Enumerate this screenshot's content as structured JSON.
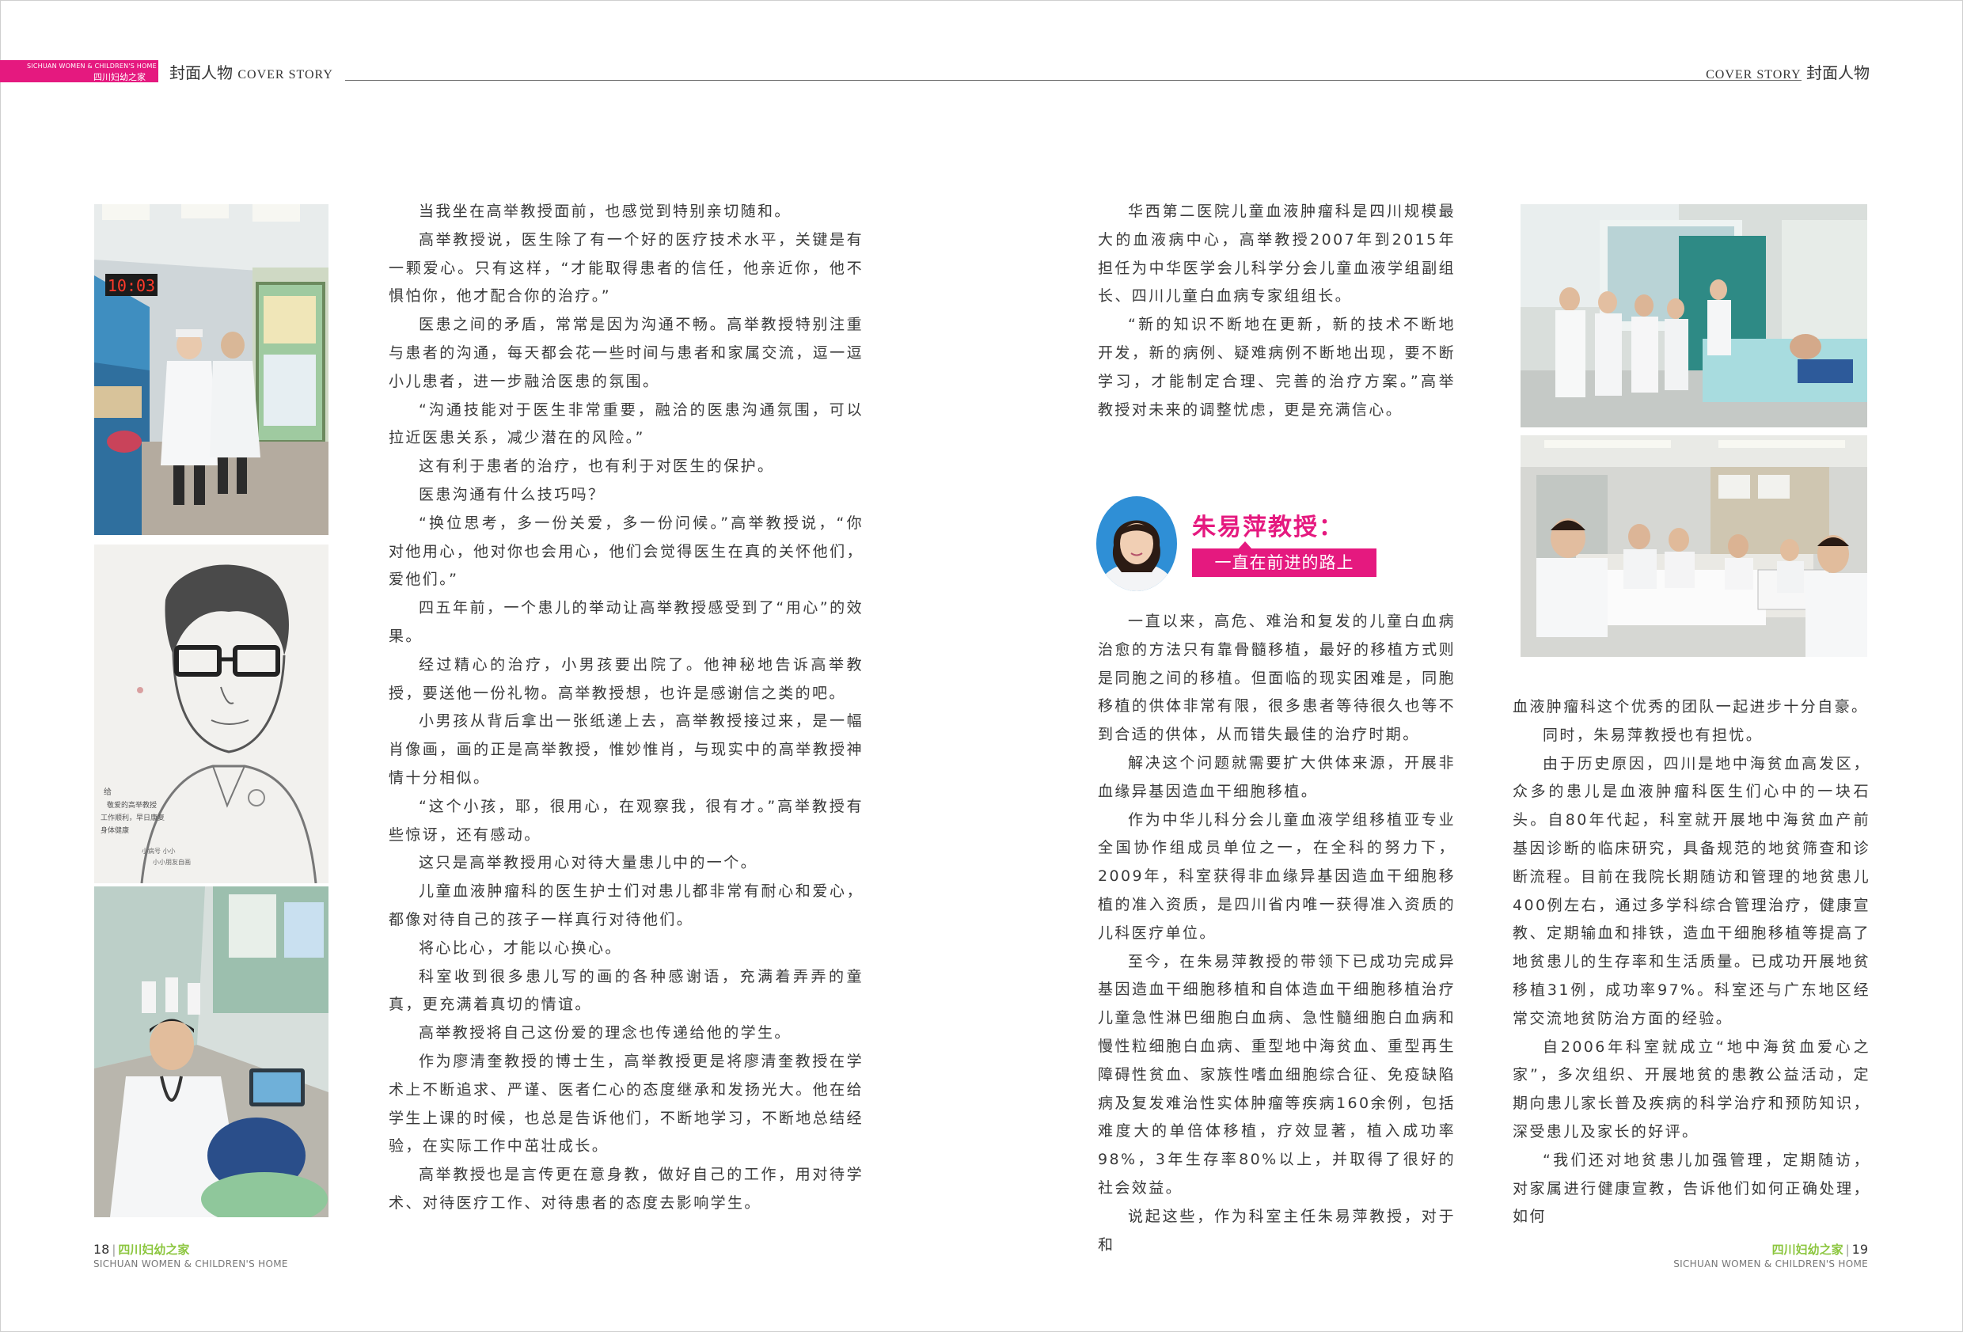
{
  "header": {
    "tab_en": "SICHUAN WOMEN & CHILDREN'S HOME",
    "tab_cn": "四川妇幼之家",
    "left_cn": "封面人物",
    "left_en": "COVER STORY",
    "right_en": "COVER STORY",
    "right_cn": "封面人物"
  },
  "photos": {
    "clock_text": "10:03",
    "drawing_note_1": "给",
    "drawing_note_2": "敬爱的高举教授",
    "drawing_note_3": "工作顺利，早日康复",
    "drawing_note_4": "身体健康",
    "drawing_note_5": "小病号 小小",
    "drawing_note_6": "小小朋友自画"
  },
  "left_page": {
    "paragraphs": [
      "当我坐在高举教授面前，也感觉到特别亲切随和。",
      "高举教授说，医生除了有一个好的医疗技术水平，关键是有一颗爱心。只有这样，“才能取得患者的信任，他亲近你，他不惧怕你，他才配合你的治疗。”",
      "医患之间的矛盾，常常是因为沟通不畅。高举教授特别注重与患者的沟通，每天都会花一些时间与患者和家属交流，逗一逗小儿患者，进一步融洽医患的氛围。",
      "“沟通技能对于医生非常重要，融洽的医患沟通氛围，可以拉近医患关系，减少潜在的风险。”",
      "这有利于患者的治疗，也有利于对医生的保护。",
      "医患沟通有什么技巧吗？",
      "“换位思考，多一份关爱，多一份问候。”高举教授说，“你对他用心，他对你也会用心，他们会觉得医生在真的关怀他们，爱他们。”",
      "四五年前，一个患儿的举动让高举教授感受到了“用心”的效果。",
      "经过精心的治疗，小男孩要出院了。他神秘地告诉高举教授，要送他一份礼物。高举教授想，也许是感谢信之类的吧。",
      "小男孩从背后拿出一张纸递上去，高举教授接过来，是一幅肖像画，画的正是高举教授，惟妙惟肖，与现实中的高举教授神情十分相似。",
      "“这个小孩，耶，很用心，在观察我，很有才。”高举教授有些惊讶，还有感动。",
      "这只是高举教授用心对待大量患儿中的一个。",
      "儿童血液肿瘤科的医生护士们对患儿都非常有耐心和爱心，都像对待自己的孩子一样真行对待他们。",
      "将心比心，才能以心换心。",
      "科室收到很多患儿写的画的各种感谢语，充满着弄弄的童真，更充满着真切的情谊。",
      "高举教授将自己这份爱的理念也传递给他的学生。",
      "作为廖清奎教授的博士生，高举教授更是将廖清奎教授在学术上不断追求、严谨、医者仁心的态度继承和发扬光大。他在给学生上课的时候，也总是告诉他们，不断地学习，不断地总结经验，在实际工作中茁壮成长。",
      "高举教授也是言传更在意身教，做好自己的工作，用对待学术、对待医疗工作、对待患者的态度去影响学生。"
    ]
  },
  "right_page": {
    "col1_top": [
      "华西第二医院儿童血液肿瘤科是四川规模最大的血液病中心，高举教授2007年到2015年担任为中华医学会儿科学分会儿童血液学组副组长、四川儿童白血病专家组组长。",
      "“新的知识不断地在更新，新的技术不断地开发，新的病例、疑难病例不断地出现，要不断学习，才能制定合理、完善的治疗方案。”高举教授对未来的调整忧虑，更是充满信心。"
    ],
    "section": {
      "name": "朱易萍教授：",
      "tagline": "一直在前进的路上"
    },
    "col1_bottom": [
      "一直以来，高危、难治和复发的儿童白血病治愈的方法只有靠骨髓移植，最好的移植方式则是同胞之间的移植。但面临的现实困难是，同胞移植的供体非常有限，很多患者等待很久也等不到合适的供体，从而错失最佳的治疗时期。",
      "解决这个问题就需要扩大供体来源，开展非血缘异基因造血干细胞移植。",
      "作为中华儿科分会儿童血液学组移植亚专业全国协作组成员单位之一，在全科的努力下，2009年，科室获得非血缘异基因造血干细胞移植的准入资质，是四川省内唯一获得准入资质的儿科医疗单位。",
      "至今，在朱易萍教授的带领下已成功完成异基因造血干细胞移植和自体造血干细胞移植治疗儿童急性淋巴细胞白血病、急性髓细胞白血病和慢性粒细胞白血病、重型地中海贫血、重型再生障碍性贫血、家族性嗜血细胞综合征、免疫缺陷病及复发难治性实体肿瘤等疾病160余例，包括难度大的单倍体移植，疗效显著，植入成功率98%，3年生存率80%以上，并取得了很好的社会效益。",
      "说起这些，作为科室主任朱易萍教授，对于和"
    ],
    "col2": [
      "血液肿瘤科这个优秀的团队一起进步十分自豪。",
      "同时，朱易萍教授也有担忧。",
      "由于历史原因，四川是地中海贫血高发区，众多的患儿是血液肿瘤科医生们心中的一块石头。自80年代起，科室就开展地中海贫血产前基因诊断的临床研究，具备规范的地贫筛查和诊断流程。目前在我院长期随访和管理的地贫患儿400例左右，通过多学科综合管理治疗，健康宣教、定期输血和排铁，造血干细胞移植等提高了地贫患儿的生存率和生活质量。已成功开展地贫移植31例，成功率97%。科室还与广东地区经常交流地贫防治方面的经验。",
      "自2006年科室就成立“地中海贫血爱心之家”，多次组织、开展地贫的患教公益活动，定期向患儿家长普及疾病的科学治疗和预防知识，深受患儿及家长的好评。",
      "“我们还对地贫患儿加强管理，定期随访，对家属进行健康宣教，告诉他们如何正确处理，如何"
    ]
  },
  "footer": {
    "left_num": "18",
    "left_mag": "四川妇幼之家",
    "left_en": "SICHUAN WOMEN & CHILDREN'S HOME",
    "right_mag": "四川妇幼之家",
    "right_num": "19",
    "right_en": "SICHUAN WOMEN & CHILDREN'S HOME",
    "bar": "|"
  },
  "colors": {
    "accent": "#e5197f",
    "mag_green": "#8cc63f",
    "text": "#3a3a3a"
  }
}
